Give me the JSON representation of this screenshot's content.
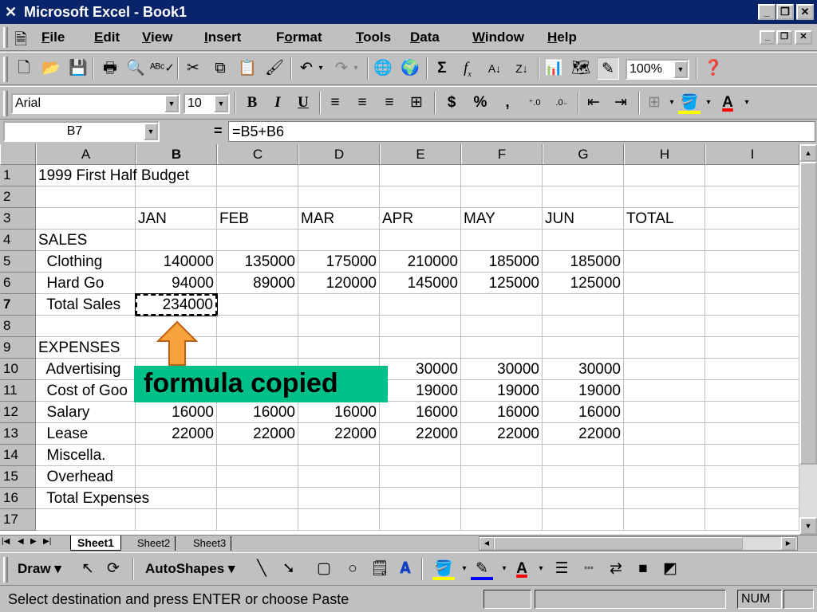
{
  "window": {
    "title": "Microsoft Excel - Book1",
    "minimize": "_",
    "restore": "❐",
    "close": "✕"
  },
  "menus": [
    {
      "u": "F",
      "rest": "ile"
    },
    {
      "u": "E",
      "rest": "dit"
    },
    {
      "u": "V",
      "rest": "iew"
    },
    {
      "u": "I",
      "rest": "nsert"
    },
    {
      "pre": "F",
      "u": "o",
      "rest": "rmat"
    },
    {
      "u": "T",
      "rest": "ools"
    },
    {
      "u": "D",
      "rest": "ata"
    },
    {
      "u": "W",
      "rest": "indow"
    },
    {
      "u": "H",
      "rest": "elp"
    }
  ],
  "standard_toolbar": {
    "zoom": "100%",
    "icons": [
      "new-icon",
      "open-icon",
      "save-icon",
      "print-icon",
      "print-preview-icon",
      "spelling-icon",
      "cut-icon",
      "copy-icon",
      "paste-icon",
      "format-painter-icon",
      "undo-icon",
      "redo-icon",
      "hyperlink-icon",
      "web-toolbar-icon",
      "autosum-icon",
      "paste-function-icon",
      "sort-ascending-icon",
      "sort-descending-icon",
      "chart-wizard-icon",
      "map-icon",
      "drawing-icon",
      "help-icon"
    ]
  },
  "formatting_toolbar": {
    "font": "Arial",
    "size": "10",
    "bold": "B",
    "italic": "I",
    "underline": "U",
    "currency": "$",
    "percent": "%",
    "comma": ","
  },
  "formula_bar": {
    "name_box": "B7",
    "equals": "=",
    "formula": "=B5+B6"
  },
  "columns": [
    "A",
    "B",
    "C",
    "D",
    "E",
    "F",
    "G",
    "H",
    "I"
  ],
  "rows": [
    {
      "n": "1",
      "cells": [
        "1999 First Half Budget",
        "",
        "",
        "",
        "",
        "",
        "",
        "",
        ""
      ]
    },
    {
      "n": "2",
      "cells": [
        "",
        "",
        "",
        "",
        "",
        "",
        "",
        "",
        ""
      ]
    },
    {
      "n": "3",
      "cells": [
        "",
        "JAN",
        "FEB",
        "MAR",
        "APR",
        "MAY",
        "JUN",
        "TOTAL",
        ""
      ]
    },
    {
      "n": "4",
      "cells": [
        "SALES",
        "",
        "",
        "",
        "",
        "",
        "",
        "",
        ""
      ]
    },
    {
      "n": "5",
      "cells": [
        "  Clothing",
        "140000",
        "135000",
        "175000",
        "210000",
        "185000",
        "185000",
        "",
        ""
      ]
    },
    {
      "n": "6",
      "cells": [
        "  Hard Go",
        "94000",
        "89000",
        "120000",
        "145000",
        "125000",
        "125000",
        "",
        ""
      ]
    },
    {
      "n": "7",
      "cells": [
        "  Total Sales",
        "234000",
        "",
        "",
        "",
        "",
        "",
        "",
        ""
      ]
    },
    {
      "n": "8",
      "cells": [
        "",
        "",
        "",
        "",
        "",
        "",
        "",
        "",
        ""
      ]
    },
    {
      "n": "9",
      "cells": [
        "EXPENSES",
        "",
        "",
        "",
        "",
        "",
        "",
        "",
        ""
      ]
    },
    {
      "n": "10",
      "cells": [
        "  Advertising",
        "",
        "",
        "",
        "30000",
        "30000",
        "30000",
        "",
        ""
      ]
    },
    {
      "n": "11",
      "cells": [
        "  Cost of Goo",
        "",
        "",
        "",
        "19000",
        "19000",
        "19000",
        "",
        ""
      ]
    },
    {
      "n": "12",
      "cells": [
        "  Salary",
        "16000",
        "16000",
        "16000",
        "16000",
        "16000",
        "16000",
        "",
        ""
      ]
    },
    {
      "n": "13",
      "cells": [
        "  Lease",
        "22000",
        "22000",
        "22000",
        "22000",
        "22000",
        "22000",
        "",
        ""
      ]
    },
    {
      "n": "14",
      "cells": [
        "  Miscella.",
        "",
        "",
        "",
        "",
        "",
        "",
        "",
        ""
      ]
    },
    {
      "n": "15",
      "cells": [
        "  Overhead",
        "",
        "",
        "",
        "",
        "",
        "",
        "",
        ""
      ]
    },
    {
      "n": "16",
      "cells": [
        "  Total Expenses",
        "",
        "",
        "",
        "",
        "",
        "",
        "",
        ""
      ]
    },
    {
      "n": "17",
      "cells": [
        "",
        "",
        "",
        "",
        "",
        "",
        "",
        "",
        ""
      ]
    }
  ],
  "sheet_tabs": [
    "Sheet1",
    "Sheet2",
    "Sheet3"
  ],
  "draw_toolbar": {
    "draw": "Draw",
    "autoshapes": "AutoShapes"
  },
  "status": {
    "message": "Select destination and press ENTER or choose Paste",
    "num": "NUM"
  },
  "callout": "formula copied",
  "colors": {
    "titlebar": "#0a246a",
    "callout": "#00c08a",
    "arrow": "#f7a23c"
  }
}
